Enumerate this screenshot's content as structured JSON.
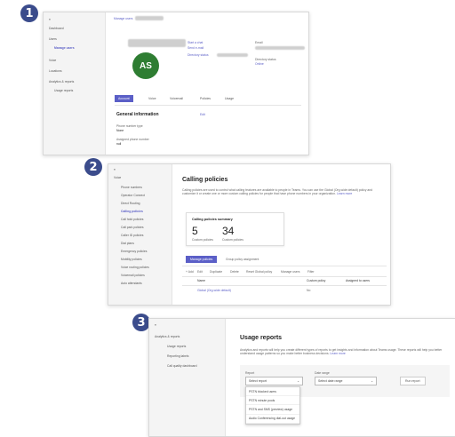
{
  "steps": [
    "1",
    "2",
    "3"
  ],
  "shot1": {
    "breadcrumb": "Manage users",
    "nav": [
      "Dashboard",
      "Users",
      "Manage users",
      "Voice",
      "Locations",
      "Analytics & reports",
      "Usage reports"
    ],
    "avatar_initials": "AS",
    "actions": [
      "Start a chat",
      "Send e-mail",
      "Directory status"
    ],
    "email_label": "Email",
    "directory_status_label": "Directory status",
    "directory_status_value": "Online",
    "tabs": [
      "Account",
      "Voice",
      "Voicemail",
      "Policies",
      "Usage"
    ],
    "section_title": "General information",
    "edit": "Edit",
    "fields": [
      {
        "label": "Phone number type",
        "value": "None"
      },
      {
        "label": "Assigned phone number",
        "value": "null"
      }
    ]
  },
  "shot2": {
    "nav": [
      "Voice",
      "Phone numbers",
      "Operator Connect",
      "Direct Routing",
      "Calling policies",
      "Call hold policies",
      "Call park policies",
      "Caller ID policies",
      "Dial plans",
      "Emergency policies",
      "Mobility policies",
      "Voice routing policies",
      "Voicemail policies",
      "Auto attendants"
    ],
    "title": "Calling policies",
    "description": "Calling policies are used to control what calling features are available to people in Teams. You can use the Global (Org-wide default) policy and customize it or create one or more custom calling policies for people that have phone numbers in your organization.",
    "learn_more": "Learn more",
    "summary_title": "Calling policies summary",
    "stats": [
      {
        "value": "5",
        "label": "Custom policies"
      },
      {
        "value": "34",
        "label": "Custom policies"
      }
    ],
    "tabs": [
      "Manage policies",
      "Group policy assignment"
    ],
    "toolbar": [
      "+ Add",
      "Edit",
      "Duplicate",
      "Delete",
      "Reset Global policy",
      "Manage users",
      "Filter"
    ],
    "columns": [
      "Name",
      "Custom policy",
      "Assigned to users"
    ],
    "rows": [
      {
        "name": "Global (Org-wide default)",
        "custom": "No"
      }
    ]
  },
  "shot3": {
    "nav": [
      "Analytics & reports",
      "Usage reports",
      "Reporting labels",
      "Call quality dashboard"
    ],
    "title": "Usage reports",
    "description": "Analytics and reports will help you create different types of reports to get insights and information about Teams usage. These reports will help you better understand usage patterns so you make better business decisions.",
    "learn_more": "Learn more",
    "report_label": "Report",
    "report_placeholder": "Select report",
    "date_label": "Date range",
    "date_placeholder": "Select date range",
    "run_button": "Run report",
    "options": [
      "PSTN blocked users",
      "PSTN minute pools",
      "PSTN and SMS (preview) usage",
      "Audio Conferencing dial-out usage"
    ]
  },
  "colors": {
    "accent": "#5b5fc7",
    "step": "#3b4c8c",
    "avatar": "#2e7d32"
  }
}
